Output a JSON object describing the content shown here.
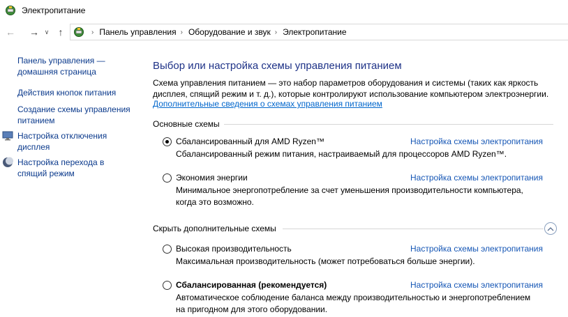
{
  "window": {
    "title": "Электропитание"
  },
  "nav": {
    "back_icon": "arrow-left-icon",
    "forward_icon": "arrow-right-icon",
    "recent_icon": "chevron-down-icon",
    "up_icon": "arrow-up-icon"
  },
  "breadcrumbs": [
    "Панель управления",
    "Оборудование и звук",
    "Электропитание"
  ],
  "sidebar": {
    "items": [
      {
        "line1": "Панель управления —",
        "line2": "домашняя страница",
        "icon": ""
      },
      {
        "line1": "Действия кнопок питания",
        "line2": "",
        "icon": ""
      },
      {
        "line1": "Создание схемы управления",
        "line2": "питанием",
        "icon": ""
      },
      {
        "line1": "Настройка отключения",
        "line2": "дисплея",
        "icon": "monitor-icon"
      },
      {
        "line1": "Настройка перехода в",
        "line2": "спящий режим",
        "icon": "moon-icon"
      }
    ]
  },
  "main": {
    "title": "Выбор или настройка схемы управления питанием",
    "description_line1": "Схема управления питанием — это набор параметров оборудования и системы (таких как яркость",
    "description_line2": "дисплея, спящий режим и т. д.), которые контролируют использование компьютером электроэнергии.",
    "more_link": "Дополнительные сведения о схемах управления питанием",
    "basic_section": "Основные схемы",
    "extra_section": "Скрыть дополнительные схемы",
    "settings_link": "Настройка схемы электропитания",
    "plans": [
      {
        "name": "Сбалансированный для AMD Ryzen™",
        "selected": true,
        "bold": false,
        "desc_line1": "Сбалансированный режим питания, настраиваемый для процессоров AMD Ryzen™.",
        "desc_line2": ""
      },
      {
        "name": "Экономия энергии",
        "selected": false,
        "bold": false,
        "desc_line1": "Минимальное энергопотребление за счет уменьшения производительности компьютера,",
        "desc_line2": "когда это возможно."
      },
      {
        "name": "Высокая производительность",
        "selected": false,
        "bold": false,
        "desc_line1": "Максимальная производительность (может потребоваться больше энергии).",
        "desc_line2": ""
      },
      {
        "name": "Сбалансированная (рекомендуется)",
        "selected": false,
        "bold": true,
        "desc_line1": "Автоматическое соблюдение баланса между производительностью и энергопотреблением",
        "desc_line2": "на пригодном для этого оборудовании."
      }
    ]
  }
}
